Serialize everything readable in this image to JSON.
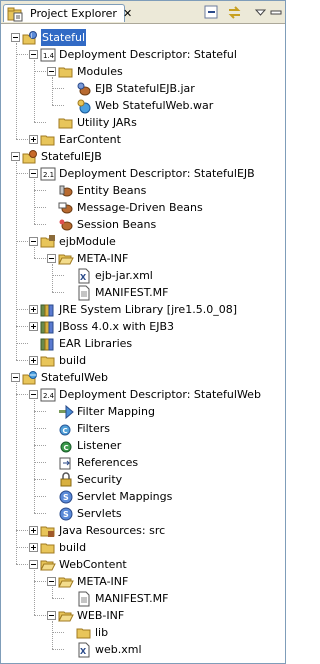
{
  "view": {
    "title": "Project Explorer",
    "close_glyph": "✕"
  },
  "toolbar": {
    "collapse_icon": "collapse-all-icon",
    "link_icon": "link-with-editor-icon",
    "menu_icon": "view-menu-icon"
  },
  "tree": [
    {
      "label": "Stateful",
      "depth": 0,
      "toggle": "open",
      "icon": "ear-project-icon",
      "selected": true
    },
    {
      "label": "Deployment Descriptor: Stateful",
      "depth": 1,
      "toggle": "open",
      "icon": "descriptor-14-icon"
    },
    {
      "label": "Modules",
      "depth": 2,
      "toggle": "open",
      "icon": "folder-icon"
    },
    {
      "label": "EJB StatefulEJB.jar",
      "depth": 3,
      "toggle": null,
      "icon": "ejb-module-icon"
    },
    {
      "label": "Web StatefulWeb.war",
      "depth": 3,
      "toggle": null,
      "icon": "web-module-icon"
    },
    {
      "label": "Utility JARs",
      "depth": 2,
      "toggle": null,
      "icon": "folder-icon"
    },
    {
      "label": "EarContent",
      "depth": 1,
      "toggle": "closed",
      "icon": "folder-icon"
    },
    {
      "label": "StatefulEJB",
      "depth": 0,
      "toggle": "open",
      "icon": "ejb-project-icon"
    },
    {
      "label": "Deployment Descriptor: StatefulEJB",
      "depth": 1,
      "toggle": "open",
      "icon": "descriptor-21-icon"
    },
    {
      "label": "Entity Beans",
      "depth": 2,
      "toggle": null,
      "icon": "entity-bean-icon"
    },
    {
      "label": "Message-Driven Beans",
      "depth": 2,
      "toggle": null,
      "icon": "mdb-icon"
    },
    {
      "label": "Session Beans",
      "depth": 2,
      "toggle": null,
      "icon": "session-bean-icon"
    },
    {
      "label": "ejbModule",
      "depth": 1,
      "toggle": "open",
      "icon": "source-folder-icon"
    },
    {
      "label": "META-INF",
      "depth": 2,
      "toggle": "open",
      "icon": "folder-open-icon"
    },
    {
      "label": "ejb-jar.xml",
      "depth": 3,
      "toggle": null,
      "icon": "xml-file-icon"
    },
    {
      "label": "MANIFEST.MF",
      "depth": 3,
      "toggle": null,
      "icon": "text-file-icon"
    },
    {
      "label": "JRE System Library [jre1.5.0_08]",
      "depth": 1,
      "toggle": "closed",
      "icon": "library-icon"
    },
    {
      "label": "JBoss 4.0.x with EJB3",
      "depth": 1,
      "toggle": "closed",
      "icon": "library-icon"
    },
    {
      "label": "EAR Libraries",
      "depth": 1,
      "toggle": null,
      "icon": "library-icon"
    },
    {
      "label": "build",
      "depth": 1,
      "toggle": "closed",
      "icon": "folder-icon"
    },
    {
      "label": "StatefulWeb",
      "depth": 0,
      "toggle": "open",
      "icon": "web-project-icon"
    },
    {
      "label": "Deployment Descriptor: StatefulWeb",
      "depth": 1,
      "toggle": "open",
      "icon": "descriptor-24-icon"
    },
    {
      "label": "Filter Mapping",
      "depth": 2,
      "toggle": null,
      "icon": "filter-mapping-icon"
    },
    {
      "label": "Filters",
      "depth": 2,
      "toggle": null,
      "icon": "filter-icon"
    },
    {
      "label": "Listener",
      "depth": 2,
      "toggle": null,
      "icon": "listener-icon"
    },
    {
      "label": "References",
      "depth": 2,
      "toggle": null,
      "icon": "references-icon"
    },
    {
      "label": "Security",
      "depth": 2,
      "toggle": null,
      "icon": "security-icon"
    },
    {
      "label": "Servlet Mappings",
      "depth": 2,
      "toggle": null,
      "icon": "servlet-mapping-icon"
    },
    {
      "label": "Servlets",
      "depth": 2,
      "toggle": null,
      "icon": "servlet-icon"
    },
    {
      "label": "Java Resources: src",
      "depth": 1,
      "toggle": "closed",
      "icon": "java-resources-icon"
    },
    {
      "label": "build",
      "depth": 1,
      "toggle": "closed",
      "icon": "folder-icon"
    },
    {
      "label": "WebContent",
      "depth": 1,
      "toggle": "open",
      "icon": "folder-open-icon"
    },
    {
      "label": "META-INF",
      "depth": 2,
      "toggle": "open",
      "icon": "folder-open-icon"
    },
    {
      "label": "MANIFEST.MF",
      "depth": 3,
      "toggle": null,
      "icon": "text-file-icon"
    },
    {
      "label": "WEB-INF",
      "depth": 2,
      "toggle": "open",
      "icon": "folder-open-icon"
    },
    {
      "label": "lib",
      "depth": 3,
      "toggle": null,
      "icon": "folder-icon"
    },
    {
      "label": "web.xml",
      "depth": 3,
      "toggle": null,
      "icon": "xml-file-icon"
    }
  ],
  "colors": {
    "folder": "#e8c55a",
    "selection": "#316ac5",
    "frame": "#7f9db9"
  }
}
